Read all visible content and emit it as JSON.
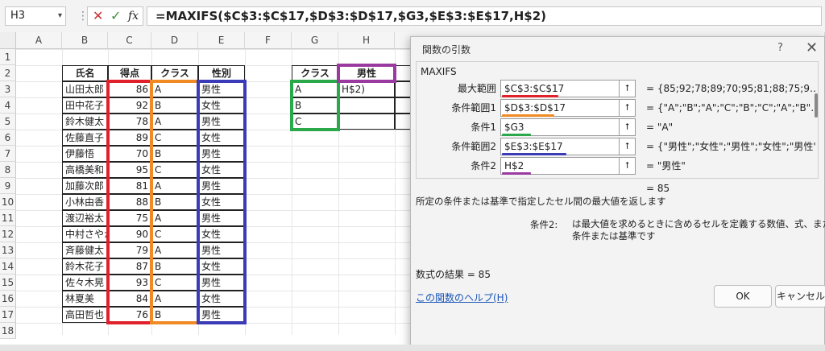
{
  "formula_bar": {
    "name_box": "H3",
    "cancel_icon": "✕",
    "enter_icon": "✓",
    "fx_icon": "fx",
    "formula": "=MAXIFS($C$3:$C$17,$D$3:$D$17,$G3,$E$3:$E$17,H$2)"
  },
  "columns": [
    "A",
    "B",
    "C",
    "D",
    "E",
    "F",
    "G",
    "H"
  ],
  "rows": [
    "1",
    "2",
    "3",
    "4",
    "5",
    "6",
    "7",
    "8",
    "9",
    "10",
    "11",
    "12",
    "13",
    "14",
    "15",
    "16",
    "17",
    "18"
  ],
  "table": {
    "headers": [
      "氏名",
      "得点",
      "クラス",
      "性別"
    ],
    "rows": [
      [
        "山田太郎",
        "86",
        "A",
        "男性"
      ],
      [
        "田中花子",
        "92",
        "B",
        "女性"
      ],
      [
        "鈴木健太",
        "78",
        "A",
        "男性"
      ],
      [
        "佐藤直子",
        "89",
        "C",
        "女性"
      ],
      [
        "伊藤悟",
        "70",
        "B",
        "男性"
      ],
      [
        "高橋美和",
        "95",
        "C",
        "女性"
      ],
      [
        "加藤次郎",
        "81",
        "A",
        "男性"
      ],
      [
        "小林由香",
        "88",
        "B",
        "女性"
      ],
      [
        "渡辺裕太",
        "75",
        "A",
        "男性"
      ],
      [
        "中村さやか",
        "90",
        "C",
        "女性"
      ],
      [
        "斉藤健太",
        "79",
        "A",
        "男性"
      ],
      [
        "鈴木花子",
        "87",
        "B",
        "女性"
      ],
      [
        "佐々木晃",
        "93",
        "C",
        "男性"
      ],
      [
        "林夏美",
        "84",
        "A",
        "女性"
      ],
      [
        "高田哲也",
        "76",
        "B",
        "男性"
      ]
    ]
  },
  "lookup": {
    "header_class": "クラス",
    "header_gender": "男性",
    "classes": [
      "A",
      "B",
      "C"
    ],
    "h3_text": "H$2)"
  },
  "highlight_colors": {
    "red": "#e0202a",
    "orange": "#f08a24",
    "blue": "#3b3bb8",
    "green": "#2aa84a",
    "purple": "#9a3aa0"
  },
  "dialog": {
    "title": "関数の引数",
    "help_glyph": "?",
    "close_glyph": "✕",
    "function_name": "MAXIFS",
    "args": [
      {
        "label": "最大範囲",
        "value": "$C$3:$C$17",
        "result": "=  {85;92;78;89;70;95;81;88;75;9…",
        "color": "#e0202a"
      },
      {
        "label": "条件範囲1",
        "value": "$D$3:$D$17",
        "result": "=  {\"A\";\"B\";\"A\";\"C\";\"B\";\"C\";\"A\";\"B\"…",
        "color": "#f08a24"
      },
      {
        "label": "条件1",
        "value": "$G3",
        "result": "=  \"A\"",
        "color": "#2aa84a"
      },
      {
        "label": "条件範囲2",
        "value": "$E$3:$E$17",
        "result": "=  {\"男性\";\"女性\";\"男性\";\"女性\";\"男性\"",
        "color": "#3b3bb8"
      },
      {
        "label": "条件2",
        "value": "H$2",
        "result": "=  \"男性\"",
        "color": "#9a3aa0"
      }
    ],
    "ref_button_glyph": "⭡",
    "result_inline": "=  85",
    "description": "所定の条件または基準で指定したセル間の最大値を返します",
    "arg_desc_label": "条件2:",
    "arg_desc_line1": "は最大値を求めるときに含めるセルを定義する数値、式、またはテキストの形式の",
    "arg_desc_line2": "条件または基準です",
    "formula_result": "数式の結果 =   85",
    "help_link": "この関数のヘルプ(H)",
    "ok": "OK",
    "cancel": "キャンセル"
  }
}
